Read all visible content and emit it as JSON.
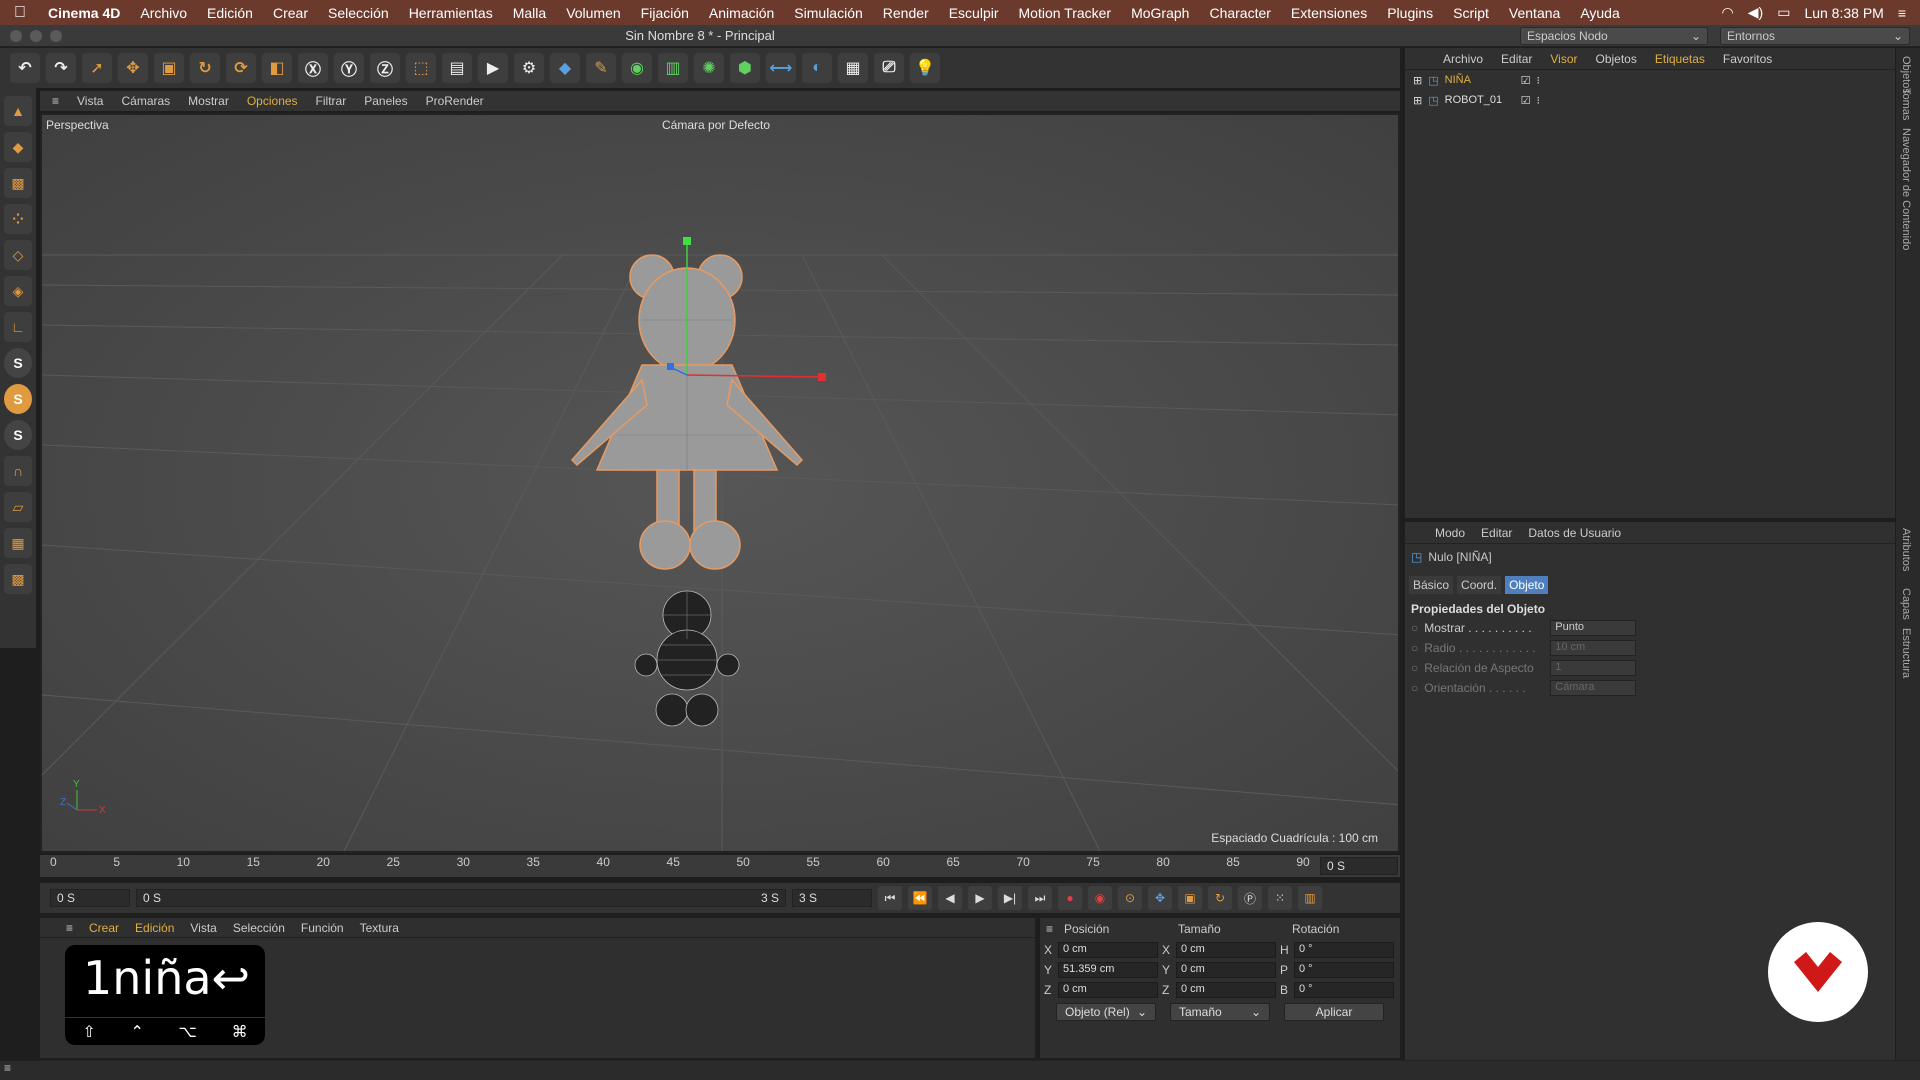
{
  "mac_menu": {
    "app_name": "Cinema 4D",
    "items": [
      "Archivo",
      "Edición",
      "Crear",
      "Selección",
      "Herramientas",
      "Malla",
      "Volumen",
      "Fijación",
      "Animación",
      "Simulación",
      "Render",
      "Esculpir",
      "Motion Tracker",
      "MoGraph",
      "Character",
      "Extensiones",
      "Plugins",
      "Script",
      "Ventana",
      "Ayuda"
    ],
    "clock": "Lun 8:38 PM"
  },
  "window": {
    "title": "Sin Nombre 8 * - Principal",
    "layout_dropdown": "Espacios Nodo",
    "env_dropdown": "Entornos"
  },
  "viewport_menu": [
    "Vista",
    "Cámaras",
    "Mostrar",
    "Opciones",
    "Filtrar",
    "Paneles",
    "ProRender"
  ],
  "viewport_menu_active": "Opciones",
  "viewport": {
    "label": "Perspectiva",
    "camera": "Cámara por Defecto",
    "grid_spacing": "Espaciado Cuadrícula : 100 cm"
  },
  "timeline": {
    "ticks": [
      "0",
      "5",
      "10",
      "15",
      "20",
      "25",
      "30",
      "35",
      "40",
      "45",
      "50",
      "55",
      "60",
      "65",
      "70",
      "75",
      "80",
      "85",
      "90"
    ],
    "current_frame": "0 S",
    "start": "0 S",
    "range_start": "0 S",
    "range_end": "3 S",
    "end": "3 S"
  },
  "material_menu": [
    "Crear",
    "Edición",
    "Vista",
    "Selección",
    "Función",
    "Textura"
  ],
  "keycast": {
    "text": "1niña↩",
    "modifiers": [
      "⇧",
      "⌃",
      "⌥",
      "⌘"
    ]
  },
  "coords": {
    "headers": [
      "Posición",
      "Tamaño",
      "Rotación"
    ],
    "rows": [
      {
        "axis": "X",
        "pos": "0 cm",
        "size_axis": "X",
        "size": "0 cm",
        "rot_axis": "H",
        "rot": "0 °"
      },
      {
        "axis": "Y",
        "pos": "51.359 cm",
        "size_axis": "Y",
        "size": "0 cm",
        "rot_axis": "P",
        "rot": "0 °"
      },
      {
        "axis": "Z",
        "pos": "0 cm",
        "size_axis": "Z",
        "size": "0 cm",
        "rot_axis": "B",
        "rot": "0 °"
      }
    ],
    "mode_select": "Objeto (Rel)",
    "size_select": "Tamaño",
    "apply": "Aplicar"
  },
  "objects_panel": {
    "menu": [
      "Archivo",
      "Editar",
      "Visor",
      "Objetos",
      "Etiquetas",
      "Favoritos"
    ],
    "objects": [
      {
        "name": "NIÑA",
        "selected": true
      },
      {
        "name": "ROBOT_01",
        "selected": false
      }
    ]
  },
  "attributes_panel": {
    "menu": [
      "Modo",
      "Editar",
      "Datos de Usuario"
    ],
    "object_title": "Nulo [NIÑA]",
    "tabs": [
      "Básico",
      "Coord.",
      "Objeto"
    ],
    "active_tab": "Objeto",
    "section": "Propiedades del Objeto",
    "props": [
      {
        "label": "Mostrar . . . . . . . . . .",
        "value": "Punto",
        "disabled": false
      },
      {
        "label": "Radio . . . . . . . . . . . .",
        "value": "10 cm",
        "disabled": true
      },
      {
        "label": "Relación de Aspecto",
        "value": "1",
        "disabled": true
      },
      {
        "label": "Orientación . . . . . .",
        "value": "Cámara",
        "disabled": true
      }
    ]
  },
  "side_tabs": [
    "Objetos",
    "Tomas",
    "Navegador de Contenido",
    "Atributos",
    "Capas",
    "Estructura"
  ],
  "colors": {
    "accent": "#e0b040",
    "selection_blue": "#4f7fbf",
    "mac_bar": "#6b3a2c"
  }
}
